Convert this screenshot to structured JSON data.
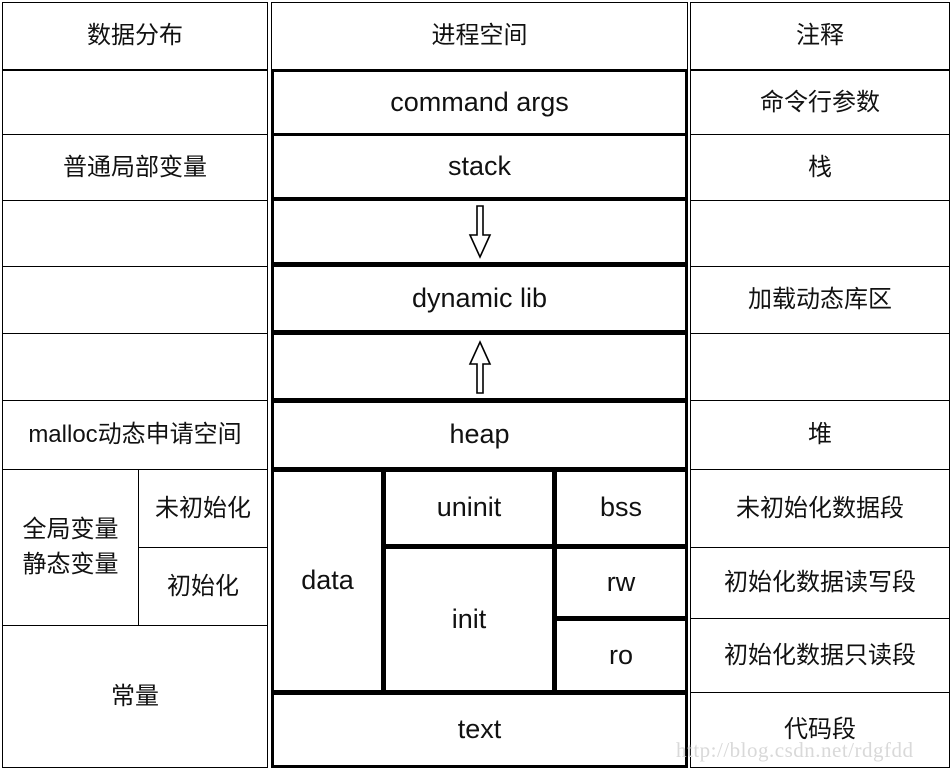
{
  "diagram": {
    "title_columns": {
      "left": "数据分布",
      "middle": "进程空间",
      "right": "注释"
    },
    "left_column": {
      "rows": [
        {
          "label": ""
        },
        {
          "label": "普通局部变量"
        },
        {
          "label": ""
        },
        {
          "label": ""
        },
        {
          "label": ""
        },
        {
          "label": "malloc动态申请空间"
        },
        {
          "label": "常量"
        }
      ],
      "variables_group": {
        "line1": "全局变量",
        "line2": "静态变量",
        "uninitialized": "未初始化",
        "initialized": "初始化"
      }
    },
    "middle_column": {
      "command_args": "command args",
      "stack": "stack",
      "arrow_down": "down-arrow",
      "dynamic_lib": "dynamic lib",
      "arrow_up": "up-arrow",
      "heap": "heap",
      "data": "data",
      "uninit": "uninit",
      "init": "init",
      "bss": "bss",
      "rw": "rw",
      "ro": "ro",
      "text": "text"
    },
    "right_column": {
      "command_args_note": "命令行参数",
      "stack_note": "栈",
      "gap1_note": "",
      "dynamic_lib_note": "加载动态库区",
      "gap2_note": "",
      "heap_note": "堆",
      "bss_note": "未初始化数据段",
      "rw_note": "初始化数据读写段",
      "ro_note": "初始化数据只读段",
      "text_note": "代码段"
    },
    "watermark": "http://blog.csdn.net/rdgfdd",
    "colors": {
      "border": "#000000",
      "background": "#ffffff",
      "text": "#111111",
      "watermark": "#d9d9d9"
    }
  }
}
